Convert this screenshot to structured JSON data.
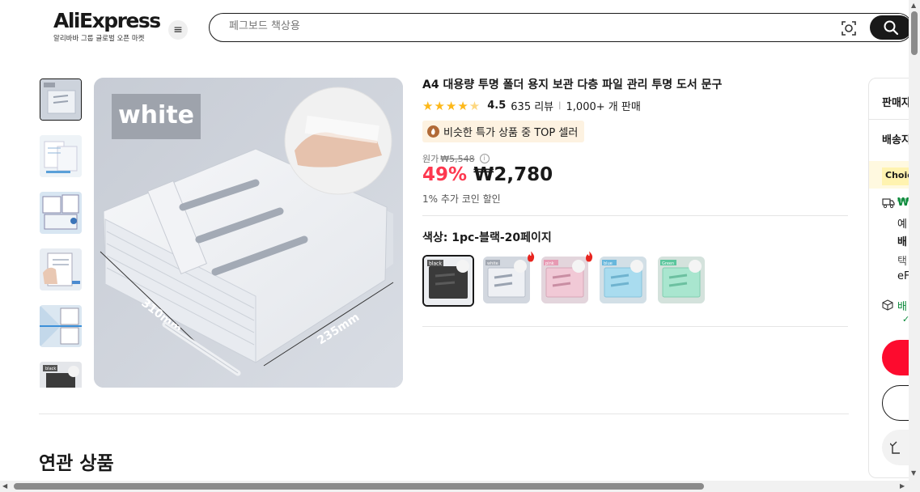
{
  "header": {
    "logo_text": "AliExpress",
    "logo_subtitle": "알리바바 그룹 글로벌 오픈 마켓",
    "menu_icon": "hamburger-icon",
    "search_placeholder": "페그보드 책상용",
    "camera_icon": "camera-search-icon",
    "search_icon": "search-icon"
  },
  "gallery": {
    "main_label": "white",
    "dim_length": "310mm",
    "dim_width": "235mm",
    "thumbnails": [
      "white",
      "detail-1",
      "detail-2",
      "detail-3",
      "detail-4",
      "black"
    ],
    "thumb_badge_black": "black",
    "thumb_badge_white": "white"
  },
  "product": {
    "title": "A4 대용량 투명 폴더 용지 보관 다층 파일 관리 투명 도서 문구",
    "rating": 4.5,
    "rating_value": "4.5",
    "reviews": "635 리뷰",
    "sold": "1,000+ 개 판매",
    "badge": "비슷한 특가 상품 중 TOP 셀러",
    "original_label": "원가",
    "original_price": "₩5,548",
    "discount": "49%",
    "price": "₩2,780",
    "coin_discount": "1% 추가 코인 할인",
    "color_label": "색상: 1pc-블랙-20페이지",
    "swatches": [
      {
        "name": "black",
        "tag": "black",
        "hot": false,
        "selected": true,
        "color": "#3a3a3a"
      },
      {
        "name": "white",
        "tag": "white",
        "hot": true,
        "selected": false,
        "color": "#dfe3ea"
      },
      {
        "name": "pink",
        "tag": "pink",
        "hot": true,
        "selected": false,
        "color": "#f1c9d6"
      },
      {
        "name": "blue",
        "tag": "blue",
        "hot": false,
        "selected": false,
        "color": "#a9dcef"
      },
      {
        "name": "green",
        "tag": "Green",
        "hot": false,
        "selected": false,
        "color": "#a9e6cf"
      }
    ]
  },
  "side_panel": {
    "seller": "판매자",
    "shipping_to": "배송지",
    "choice": "Choice",
    "shipping_price": "₩",
    "row1": "예",
    "row2": "배",
    "row3": "택",
    "row4": "eF",
    "delivery": "배",
    "check": "✓"
  },
  "related": {
    "title": "연관 상품"
  },
  "colors": {
    "accent_red": "#fd384f",
    "buy_red": "#fd0b2e",
    "star": "#fdb819",
    "badge_bg": "#fdf2e1",
    "fire": "#e8251f"
  }
}
